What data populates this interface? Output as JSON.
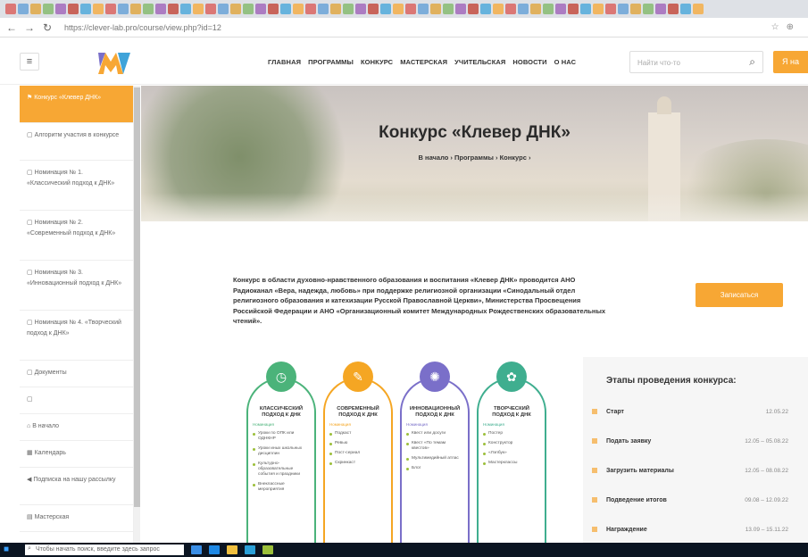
{
  "browser": {
    "url": "https://clever-lab.pro/course/view.php?id=12"
  },
  "header": {
    "menu": [
      "ГЛАВНАЯ",
      "ПРОГРАММЫ",
      "КОНКУРС",
      "МАСТЕРСКАЯ",
      "УЧИТЕЛЬСКАЯ",
      "НОВОСТИ",
      "О НАС"
    ],
    "search_placeholder": "Найти что-то",
    "user_button": "Я на"
  },
  "sidebar": {
    "items": [
      {
        "label": "Конкурс «Клевер ДНК»",
        "icon": "flag-icon"
      },
      {
        "label": "Алгоритм участия в конкурсе",
        "icon": "folder-icon"
      },
      {
        "label": "Номинация № 1. «Классический подход к ДНК»",
        "icon": "folder-icon"
      },
      {
        "label": "Номинация № 2. «Современный подход к ДНК»",
        "icon": "folder-icon"
      },
      {
        "label": "Номинация № 3. «Инновационный подход к ДНК»",
        "icon": "folder-icon"
      },
      {
        "label": "Номинация № 4. «Творческий подход к ДНК»",
        "icon": "folder-icon"
      },
      {
        "label": "Документы",
        "icon": "folder-icon"
      },
      {
        "label": "",
        "icon": "folder-icon"
      },
      {
        "label": "В начало",
        "icon": "home-icon"
      },
      {
        "label": "Календарь",
        "icon": "calendar-icon"
      },
      {
        "label": "Подписка на нашу рассылку",
        "icon": "send-icon"
      },
      {
        "label": "Мастерская",
        "icon": "book-icon"
      }
    ]
  },
  "hero": {
    "title": "Конкурс «Клевер ДНК»",
    "breadcrumbs": "В начало  ›  Программы  ›  Конкурс  ›"
  },
  "intro_text": "Конкурс в области духовно-нравственного образования и воспитания «Клевер ДНК» проводится АНО Радиоканал «Вера, надежда, любовь» при поддержке религиозной организации «Синодальный отдел религиозного образования и катехизации Русской Православной Церкви», Министерства Просвещения Российской Федерации и АНО «Организационный комитет Международных Рождественских образовательных чтений».",
  "register_button": "Записаться",
  "cards": [
    {
      "title": "КЛАССИЧЕСКИЙ ПОДХОД К ДНК",
      "subtitle": "Номинация",
      "color": "#4bb37a",
      "items": [
        "Уроки по ОПК или ОДНКНР",
        "Уроки иных школьных дисциплин",
        "Культурно-образовательные события и праздники",
        "Внеклассные мероприятия"
      ]
    },
    {
      "title": "СОВРЕМЕННЫЙ ПОДХОД К ДНК",
      "subtitle": "Номинация",
      "color": "#f5a623",
      "items": [
        "Подкаст",
        "Ревью",
        "Пост-сериал",
        "Скринкаст"
      ]
    },
    {
      "title": "ИННОВАЦИОННЫЙ ПОДХОД К ДНК",
      "subtitle": "Номинация",
      "color": "#7a6fc9",
      "items": [
        "Квест или досуги",
        "Квест «По темам квестов»",
        "Мультимедийный атлас",
        "Блог"
      ]
    },
    {
      "title": "ТВОРЧЕСКИЙ ПОДХОД К ДНК",
      "subtitle": "Номинация",
      "color": "#3fae8f",
      "items": [
        "Постер",
        "Конструктор",
        "«Лэпбук»",
        "Мастерклассы"
      ]
    }
  ],
  "stages": {
    "title": "Этапы проведения конкурса:",
    "rows": [
      {
        "name": "Старт",
        "date": "12.05.22"
      },
      {
        "name": "Подать заявку",
        "date": "12.05 – 05.08.22"
      },
      {
        "name": "Загрузить материалы",
        "date": "12.05 – 08.08.22"
      },
      {
        "name": "Подведение итогов",
        "date": "09.08 – 12.09.22"
      },
      {
        "name": "Награждение",
        "date": "13.09 – 15.11.22"
      }
    ]
  },
  "taskbar": {
    "search_text": "Чтобы начать поиск, введите здесь запрос"
  },
  "colors": {
    "accent": "#f7a734",
    "taskbar": "#0b1522"
  }
}
